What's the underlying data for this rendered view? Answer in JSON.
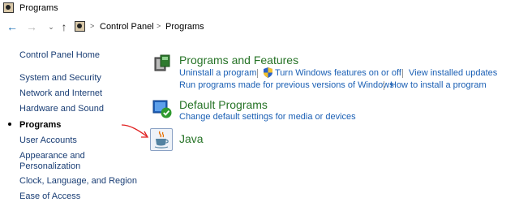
{
  "window": {
    "title": "Programs"
  },
  "nav": {
    "breadcrumb": [
      "Control Panel",
      "Programs"
    ],
    "back_icon": "back-arrow-icon",
    "forward_icon": "forward-arrow-icon",
    "recent_icon": "chevron-down-icon",
    "up_icon": "up-arrow-icon"
  },
  "sidebar": {
    "home": "Control Panel Home",
    "items": [
      {
        "label": "System and Security",
        "current": false
      },
      {
        "label": "Network and Internet",
        "current": false
      },
      {
        "label": "Hardware and Sound",
        "current": false
      },
      {
        "label": "Programs",
        "current": true
      },
      {
        "label": "User Accounts",
        "current": false
      },
      {
        "label": "Appearance and",
        "label2": "Personalization",
        "current": false
      },
      {
        "label": "Clock, Language, and Region",
        "current": false
      },
      {
        "label": "Ease of Access",
        "current": false
      }
    ]
  },
  "categories": [
    {
      "title": "Programs and Features",
      "icon": "programs-features-icon",
      "links_row1": [
        "Uninstall a program",
        "Turn Windows features on or off",
        "View installed updates"
      ],
      "links_row2": [
        "Run programs made for previous versions of Windows",
        "How to install a program"
      ]
    },
    {
      "title": "Default Programs",
      "icon": "default-programs-icon",
      "links_row1": [
        "Change default settings for media or devices"
      ]
    },
    {
      "title": "Java",
      "icon": "java-icon"
    }
  ],
  "colors": {
    "category_title": "#267326",
    "link": "#1a5fb4",
    "sidebar_link": "#1a3e75",
    "annotation_arrow": "#e02020"
  }
}
